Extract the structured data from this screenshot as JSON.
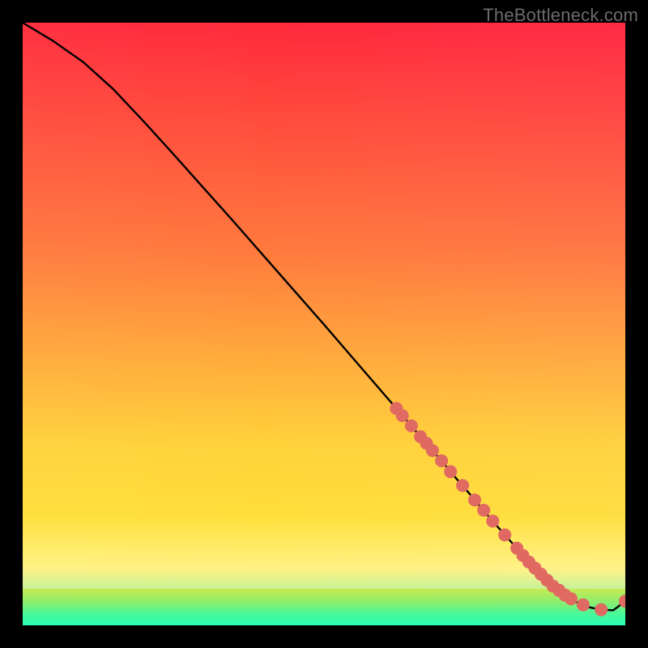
{
  "attribution": "TheBottleneck.com",
  "colors": {
    "bg_top": "#ff2a3c",
    "bg_mid1": "#ff7a3d",
    "bg_mid2": "#ffd23a",
    "bg_low": "#fff13a",
    "green": "#27e58f",
    "marker": "#e06a62",
    "curve": "#000000"
  },
  "chart_data": {
    "type": "line",
    "title": "",
    "xlabel": "",
    "ylabel": "",
    "xlim": [
      0,
      100
    ],
    "ylim": [
      0,
      100
    ],
    "grid": false,
    "legend": false,
    "note": "No axis ticks or numeric labels are shown; x/y are normalized 0–100 estimated from pixel positions.",
    "series": [
      {
        "name": "curve",
        "color": "#000000",
        "x": [
          0,
          5,
          10,
          15,
          20,
          25,
          30,
          35,
          40,
          45,
          50,
          55,
          60,
          62,
          64,
          66,
          68,
          70,
          72,
          74,
          76,
          78,
          80,
          82,
          84,
          86,
          88,
          90,
          92,
          94,
          96,
          98,
          100
        ],
        "y": [
          100,
          97,
          93.5,
          89,
          83.7,
          78.2,
          72.6,
          67,
          61.3,
          55.6,
          49.9,
          44.1,
          38.3,
          36,
          33.7,
          31.3,
          29,
          26.7,
          24.3,
          22,
          19.6,
          17.3,
          15,
          12.8,
          10.5,
          8.5,
          6.5,
          5,
          3.8,
          3,
          2.6,
          2.5,
          4.0
        ]
      }
    ],
    "markers": {
      "name": "dots",
      "color": "#e06a62",
      "radius": 8,
      "points": [
        {
          "x": 62,
          "y": 36.0
        },
        {
          "x": 63,
          "y": 34.8
        },
        {
          "x": 64.5,
          "y": 33.1
        },
        {
          "x": 66,
          "y": 31.3
        },
        {
          "x": 67,
          "y": 30.2
        },
        {
          "x": 68,
          "y": 29.0
        },
        {
          "x": 69.5,
          "y": 27.3
        },
        {
          "x": 71,
          "y": 25.5
        },
        {
          "x": 73,
          "y": 23.2
        },
        {
          "x": 75,
          "y": 20.8
        },
        {
          "x": 76.5,
          "y": 19.1
        },
        {
          "x": 78,
          "y": 17.3
        },
        {
          "x": 80,
          "y": 15.0
        },
        {
          "x": 82,
          "y": 12.8
        },
        {
          "x": 83,
          "y": 11.6
        },
        {
          "x": 84,
          "y": 10.5
        },
        {
          "x": 85,
          "y": 9.5
        },
        {
          "x": 86,
          "y": 8.5
        },
        {
          "x": 87,
          "y": 7.5
        },
        {
          "x": 88,
          "y": 6.5
        },
        {
          "x": 89,
          "y": 5.8
        },
        {
          "x": 90,
          "y": 5.0
        },
        {
          "x": 91,
          "y": 4.4
        },
        {
          "x": 93,
          "y": 3.4
        },
        {
          "x": 96,
          "y": 2.6
        },
        {
          "x": 100,
          "y": 4.0
        }
      ]
    }
  }
}
